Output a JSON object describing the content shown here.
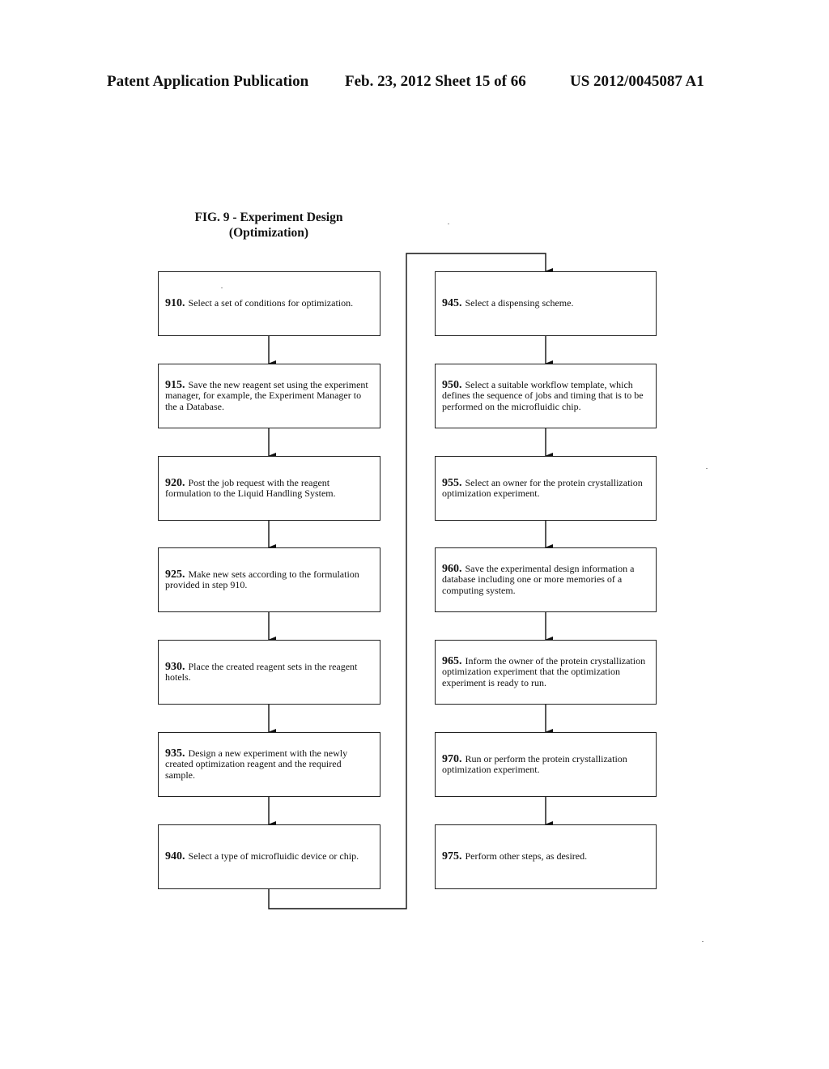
{
  "header": {
    "left": "Patent Application Publication",
    "middle": "Feb. 23, 2012  Sheet 15 of 66",
    "right": "US 2012/0045087 A1"
  },
  "figure": {
    "title_line1": "FIG. 9 - Experiment Design",
    "title_line2": "(Optimization)"
  },
  "left_column": [
    {
      "num": "910.",
      "text": "Select a set of conditions for optimization."
    },
    {
      "num": "915.",
      "text": "Save the new reagent set using the experiment manager, for example, the Experiment Manager to the a Database."
    },
    {
      "num": "920.",
      "text": "Post the job request with the reagent formulation to the Liquid Handling System."
    },
    {
      "num": "925.",
      "text": "Make new sets according to the formulation provided in step 910."
    },
    {
      "num": "930.",
      "text": "Place the created reagent sets in the reagent hotels."
    },
    {
      "num": "935.",
      "text": "Design a new experiment with the newly created optimization reagent and the required sample."
    },
    {
      "num": "940.",
      "text": "Select a type of microfluidic device or chip."
    }
  ],
  "right_column": [
    {
      "num": "945.",
      "text": "Select a dispensing scheme."
    },
    {
      "num": "950.",
      "text": "Select a suitable workflow template, which defines the sequence of jobs and timing that is to be performed on the microfluidic chip."
    },
    {
      "num": "955.",
      "text": "Select an owner for the protein crystallization optimization experiment."
    },
    {
      "num": "960.",
      "text": "Save the experimental design information a database including one or more memories of a computing system."
    },
    {
      "num": "965.",
      "text": "Inform the owner of the protein crystallization optimization experiment that the optimization experiment is ready to run."
    },
    {
      "num": "970.",
      "text": "Run or perform the protein crystallization optimization experiment."
    },
    {
      "num": "975.",
      "text": "Perform other steps, as desired."
    }
  ]
}
